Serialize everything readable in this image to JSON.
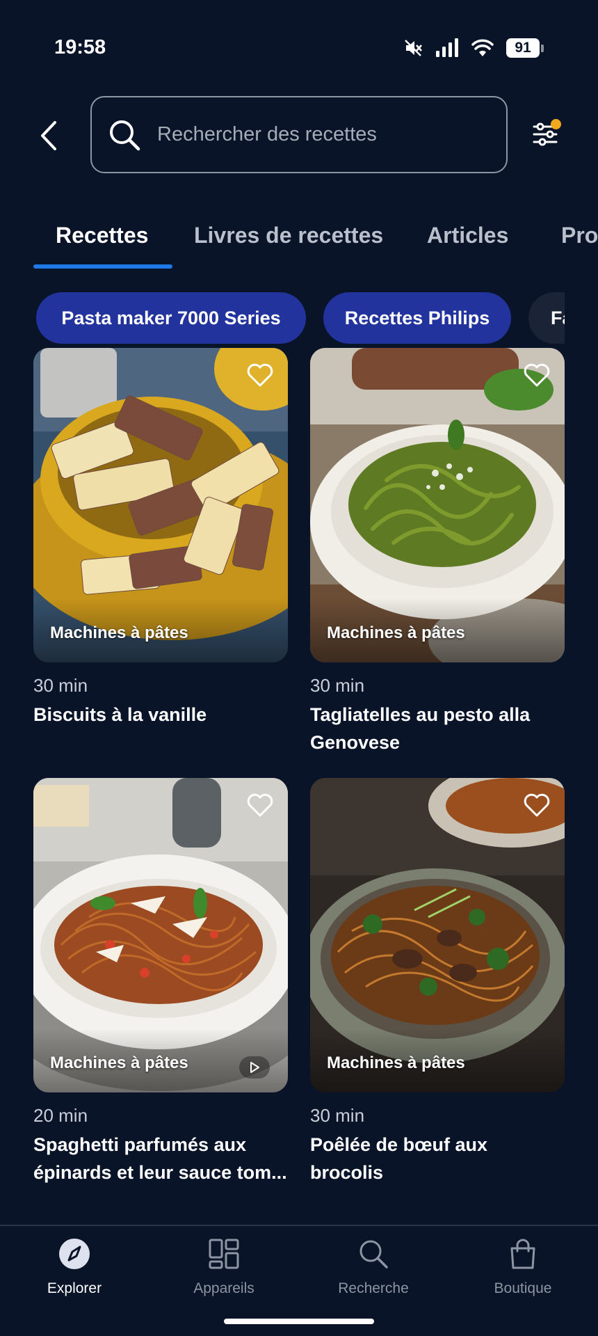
{
  "status_bar": {
    "time": "19:58",
    "battery": "91",
    "icons": [
      "mute-icon",
      "signal-icon",
      "wifi-icon",
      "battery-icon"
    ]
  },
  "search": {
    "placeholder": "Rechercher des recettes",
    "value": ""
  },
  "filter": {
    "has_active_filters": true,
    "dot_color": "#f2a81d"
  },
  "tabs": [
    {
      "label": "Recettes",
      "active": true
    },
    {
      "label": "Livres de recettes",
      "active": false
    },
    {
      "label": "Articles",
      "active": false
    },
    {
      "label": "Pro",
      "active": false
    }
  ],
  "chips": [
    {
      "label": "Pasta maker 7000 Series"
    },
    {
      "label": "Recettes Philips"
    },
    {
      "label": "Fa"
    }
  ],
  "recipes": [
    {
      "category": "Machines à pâtes",
      "time": "30 min",
      "title": "Biscuits à la vanille",
      "has_video": false
    },
    {
      "category": "Machines à pâtes",
      "time": "30 min",
      "title": "Tagliatelles au pesto alla Genovese",
      "has_video": false
    },
    {
      "category": "Machines à pâtes",
      "time": "20 min",
      "title": "Spaghetti parfumés aux épinards et leur sauce tom...",
      "has_video": true
    },
    {
      "category": "Machines à pâtes",
      "time": "30 min",
      "title": "Poêlée de bœuf aux brocolis",
      "has_video": false
    }
  ],
  "bottom_nav": [
    {
      "label": "Explorer",
      "icon": "compass-icon",
      "active": true
    },
    {
      "label": "Appareils",
      "icon": "devices-grid-icon",
      "active": false
    },
    {
      "label": "Recherche",
      "icon": "search-icon",
      "active": false
    },
    {
      "label": "Boutique",
      "icon": "shopping-bag-icon",
      "active": false
    }
  ],
  "colors": {
    "background": "#0a1428",
    "accent": "#1e78e6",
    "chip": "#22339e",
    "notification": "#f2a81d"
  }
}
